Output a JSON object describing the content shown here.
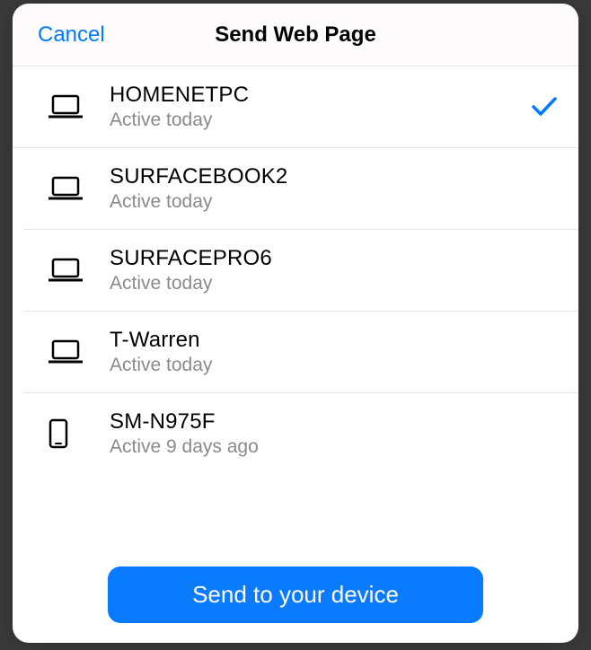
{
  "header": {
    "cancel_label": "Cancel",
    "title": "Send Web Page"
  },
  "devices": [
    {
      "name": "HOMENETPC",
      "status": "Active today",
      "type": "laptop",
      "selected": true
    },
    {
      "name": "SURFACEBOOK2",
      "status": "Active today",
      "type": "laptop",
      "selected": false
    },
    {
      "name": "SURFACEPRO6",
      "status": "Active today",
      "type": "laptop",
      "selected": false
    },
    {
      "name": "T-Warren",
      "status": "Active today",
      "type": "laptop",
      "selected": false
    },
    {
      "name": "SM-N975F",
      "status": "Active 9 days ago",
      "type": "phone",
      "selected": false
    }
  ],
  "footer": {
    "send_label": "Send to your device"
  }
}
